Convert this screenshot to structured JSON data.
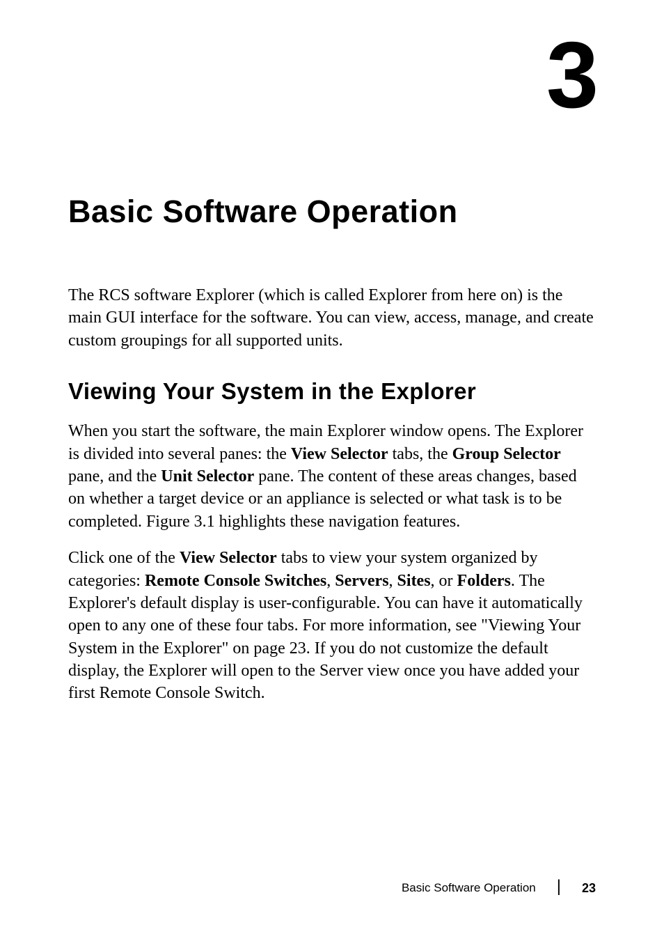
{
  "chapter": {
    "number": "3",
    "title": "Basic Software Operation"
  },
  "intro": "The RCS software Explorer (which is called Explorer from here on) is the main GUI interface for the software. You can view, access, manage, and create custom groupings for all supported units.",
  "section": {
    "heading": "Viewing Your System in the Explorer",
    "para1": {
      "pre1": "When you start the software, the main Explorer window opens. The Explorer is divided into several panes: the ",
      "bold1": "View Selector",
      "mid1": " tabs, the ",
      "bold2": "Group Selector",
      "mid2": " pane, and the ",
      "bold3": "Unit Selector",
      "post": " pane. The content of these areas changes, based on whether a target device or an appliance is selected or what task is to be completed. Figure 3.1 highlights these navigation features."
    },
    "para2": {
      "pre": "Click one of the ",
      "bold1": "View Selector",
      "mid1": " tabs to view your system organized by categories: ",
      "bold2": "Remote Console Switches",
      "sep1": ", ",
      "bold3": "Servers",
      "sep2": ", ",
      "bold4": "Sites",
      "sep3": ", or ",
      "bold5": "Folders",
      "post": ". The Explorer's default display is user-configurable. You can have it automatically open to any one of these four tabs. For more information, see \"Viewing Your System in the Explorer\" on page 23. If you do not customize the default display, the Explorer will open to the Server view once you have added your first Remote Console Switch."
    }
  },
  "footer": {
    "label": "Basic Software Operation",
    "page": "23"
  }
}
